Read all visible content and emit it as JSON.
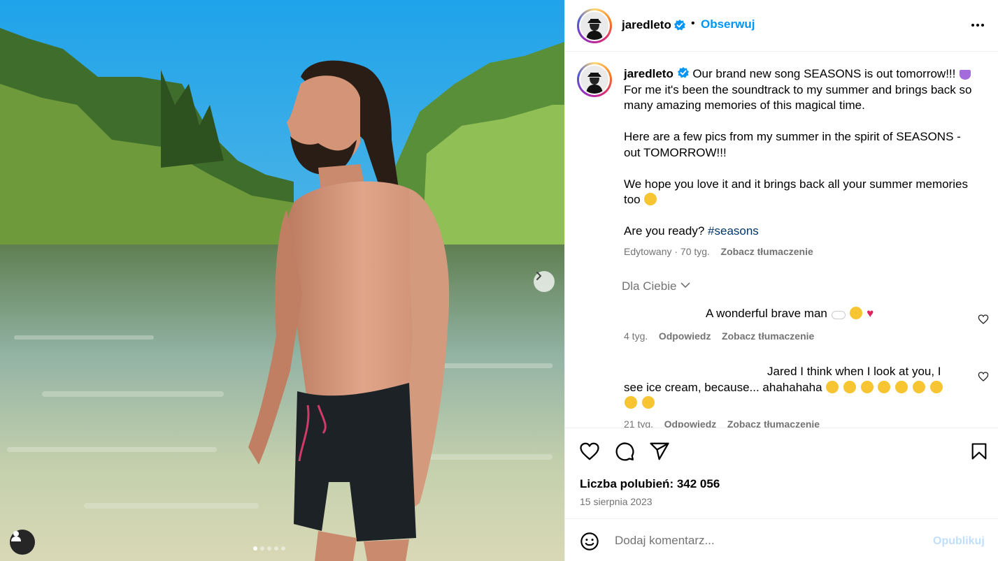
{
  "colors": {
    "accent": "#0095f6",
    "muted": "#737373",
    "hashtag": "#00376b",
    "post_disabled": "#c0dffd"
  },
  "header": {
    "username": "jaredleto",
    "bullet": "•",
    "follow_label": "Obserwuj"
  },
  "caption": {
    "username": "jaredleto",
    "line1": "Our brand new song SEASONS is out tomorrow!!!",
    "line2": "For me it's been the soundtrack to my summer and brings back so many amazing memories of this magical time.",
    "para2": "Here are a few pics from my summer in the spirit of SEASONS - out TOMORROW!!!",
    "para3": "We hope you love it and it brings back all your summer memories too",
    "para4_text": "Are you ready?",
    "hashtag": "#seasons",
    "meta_time": "Edytowany · 70 tyg.",
    "translate": "Zobacz tłumaczenie"
  },
  "filter": {
    "label": "Dla Ciebie"
  },
  "comments": [
    {
      "text": "A wonderful brave man",
      "time": "4 tyg.",
      "reply": "Odpowiedz",
      "translate": "Zobacz tłumaczenie"
    },
    {
      "text": "Jared I think when I look at you, I see ice cream, because... ahahahaha",
      "time": "21 tyg.",
      "reply": "Odpowiedz",
      "translate": "Zobacz tłumaczenie"
    }
  ],
  "stats": {
    "likes": "Liczba polubień: 342 056",
    "date": "15 sierpnia 2023"
  },
  "add_comment": {
    "placeholder": "Dodaj komentarz...",
    "post_label": "Opublikuj"
  },
  "carousel": {
    "slide_count": 5,
    "active_index": 0
  },
  "icons": [
    "verified-icon",
    "more-icon",
    "heart-icon",
    "comment-icon",
    "share-icon",
    "bookmark-icon",
    "emoji-icon",
    "chevron-right-icon",
    "user-tag-icon",
    "chevron-down-icon"
  ]
}
